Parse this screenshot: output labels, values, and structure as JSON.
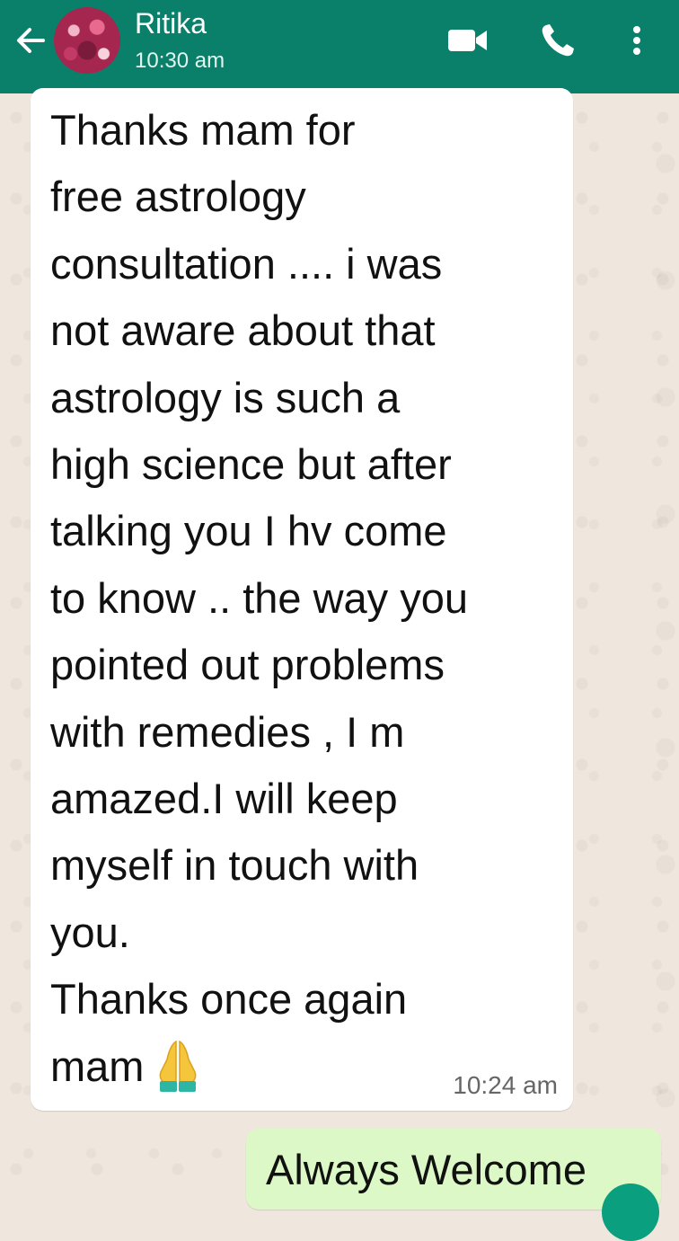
{
  "header": {
    "contact_name": "Ritika",
    "status": "10:30 am",
    "icons": [
      "back-arrow-icon",
      "avatar",
      "video-call-icon",
      "voice-call-icon",
      "more-options-icon"
    ],
    "color": "#0a7f6a"
  },
  "messages": [
    {
      "direction": "incoming",
      "text": "Thanks mam for\nfree astrology\nconsultation .... i was\nnot aware about that\nastrology is such a\nhigh science but after\ntalking you I hv come\nto know .. the way you\npointed out problems\nwith remedies , I m\namazed.I will keep\nmyself in touch with\nyou.\nThanks once again\nmam",
      "emoji": "folded-hands",
      "time": "10:24 am"
    },
    {
      "direction": "outgoing",
      "text": "Always Welcome"
    }
  ],
  "colors": {
    "incoming_bubble": "#ffffff",
    "outgoing_bubble": "#dcf8c6",
    "wallpaper": "#efe7de"
  }
}
